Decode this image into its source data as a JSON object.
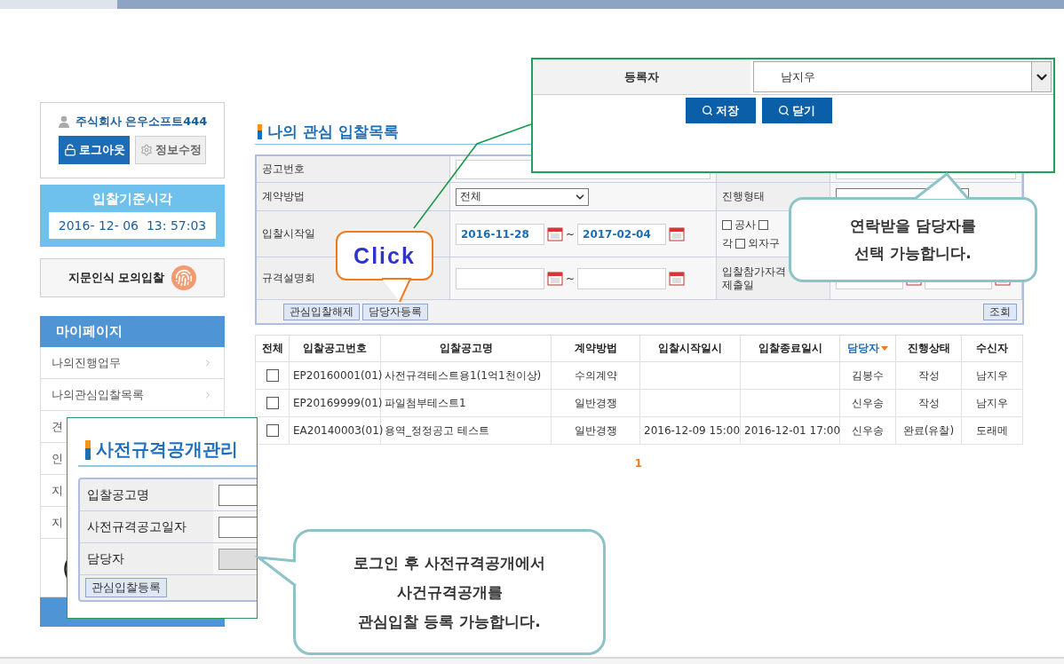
{
  "sidebar": {
    "user": "주식회사 은우소프트444",
    "buttons": [
      {
        "label": "로그아웃",
        "kind": "primary"
      },
      {
        "label": "정보수정",
        "kind": "secondary"
      }
    ],
    "clock": {
      "title": "입찰기준시각",
      "time": "2016- 12- 06  13: 57:03"
    },
    "fingerprint": "지문인식 모의입찰",
    "menu": {
      "title": "마이페이지",
      "items": [
        {
          "label": "나의진행업무",
          "arrow": true
        },
        {
          "label": "나의관심입찰목록",
          "arrow": true
        },
        {
          "label": "견"
        },
        {
          "label": "인"
        },
        {
          "label": "지"
        },
        {
          "label": "지"
        }
      ]
    },
    "partial_box": "("
  },
  "page_title": "나의 관심 입찰목록",
  "search_form": {
    "rows": [
      {
        "cells": [
          {
            "kind": "label",
            "text": "공고번호"
          },
          {
            "kind": "input"
          },
          {
            "kind": "empty"
          },
          {
            "kind": "input"
          }
        ]
      },
      {
        "cells": [
          {
            "kind": "label",
            "text": "계약방법"
          },
          {
            "kind": "select",
            "value": "전체"
          },
          {
            "kind": "label",
            "text": "진행형태"
          },
          {
            "kind": "select"
          }
        ]
      },
      {
        "cells": [
          {
            "kind": "label",
            "text": "입찰시작일"
          },
          {
            "kind": "daterange",
            "from": "2016-11-28",
            "separator": "~",
            "to": "2017-02-04"
          },
          {
            "kind": "checks",
            "lines": [
              {
                "items": [
                  {
                    "label": "공사",
                    "checked": false
                  },
                  {
                    "checked": false
                  }
                ]
              },
              {
                "lead": "각",
                "items": [
                  {
                    "label": "외자구",
                    "checked": false
                  }
                ]
              }
            ]
          },
          {
            "kind": "empty"
          }
        ]
      },
      {
        "cells": [
          {
            "kind": "label",
            "text": "규격설명회"
          },
          {
            "kind": "daterange",
            "separator": "~"
          },
          {
            "kind": "label",
            "text": "입찰참가자격\n제출일"
          },
          {
            "kind": "daterange"
          }
        ]
      }
    ],
    "actions": [
      "관심입찰해제",
      "담당자등록"
    ],
    "search_button": "조회"
  },
  "table": {
    "columns": [
      {
        "label": "전체",
        "sorted": false
      },
      {
        "label": "입찰공고번호",
        "sorted": false
      },
      {
        "label": "입찰공고명",
        "sorted": false
      },
      {
        "label": "계약방법",
        "sorted": false
      },
      {
        "label": "입찰시작일시",
        "sorted": false
      },
      {
        "label": "입찰종료일시",
        "sorted": false
      },
      {
        "label": "담당자",
        "sorted": true
      },
      {
        "label": "진행상태",
        "sorted": false
      },
      {
        "label": "수신자",
        "sorted": false
      }
    ],
    "rows": [
      {
        "checked": false,
        "cells": [
          null,
          "EP20160001(01)",
          "사전규격테스트용1(1억1천이상)",
          "수의계약",
          null,
          null,
          "김봉수",
          "작성",
          "남지우"
        ]
      },
      {
        "checked": false,
        "cells": [
          null,
          "EP20169999(01)",
          "파일첨부테스트1",
          "일반경쟁",
          null,
          null,
          "신우송",
          "작성",
          "남지우"
        ]
      },
      {
        "checked": false,
        "cells": [
          null,
          "EA20140003(01)",
          "용역_정정공고 테스트",
          "일반경쟁",
          "2016-12-09 15:00",
          "2016-12-01 17:00",
          "신우송",
          "완료(유찰)",
          "도래메"
        ]
      }
    ]
  },
  "pagination": [
    {
      "label": "1",
      "selected": true
    }
  ],
  "popup": {
    "label": "등록자",
    "value": "남지우",
    "buttons": [
      "저장",
      "닫기"
    ]
  },
  "callouts": [
    {
      "kind": "click",
      "lines": [
        "Click"
      ]
    },
    {
      "kind": "note-top",
      "lines": [
        "연락받을 담당자를",
        "선택 가능합니다."
      ]
    },
    {
      "kind": "note-bottom",
      "lines": [
        "로그인 후 사전규격공개에서",
        "사건규격공개를",
        "관심입찰 등록 가능합니다."
      ]
    }
  ],
  "inset": {
    "title": "사전규격공개관리",
    "fields": [
      {
        "label": "입찰공고명",
        "kind": "input"
      },
      {
        "label": "사전규격공고일자",
        "kind": "input"
      },
      {
        "label": "담당자",
        "kind": "readonly"
      }
    ],
    "button": "관심입찰등록"
  }
}
